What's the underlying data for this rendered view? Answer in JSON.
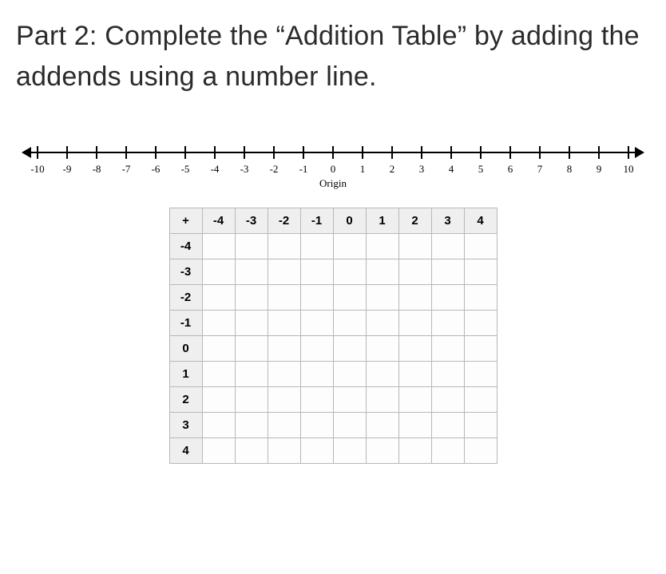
{
  "instruction": "Part 2: Complete the “Addition Table” by adding the addends using a number line.",
  "number_line": {
    "ticks": [
      "-10",
      "-9",
      "-8",
      "-7",
      "-6",
      "-5",
      "-4",
      "-3",
      "-2",
      "-1",
      "0",
      "1",
      "2",
      "3",
      "4",
      "5",
      "6",
      "7",
      "8",
      "9",
      "10"
    ],
    "origin_label": "Origin"
  },
  "table": {
    "corner": "+",
    "col_headers": [
      "-4",
      "-3",
      "-2",
      "-1",
      "0",
      "1",
      "2",
      "3",
      "4"
    ],
    "row_headers": [
      "-4",
      "-3",
      "-2",
      "-1",
      "0",
      "1",
      "2",
      "3",
      "4"
    ]
  },
  "chart_data": {
    "type": "table",
    "title": "Addition Table",
    "col_addends": [
      -4,
      -3,
      -2,
      -1,
      0,
      1,
      2,
      3,
      4
    ],
    "row_addends": [
      -4,
      -3,
      -2,
      -1,
      0,
      1,
      2,
      3,
      4
    ],
    "cells_filled": false,
    "number_line_range": [
      -10,
      10
    ]
  }
}
